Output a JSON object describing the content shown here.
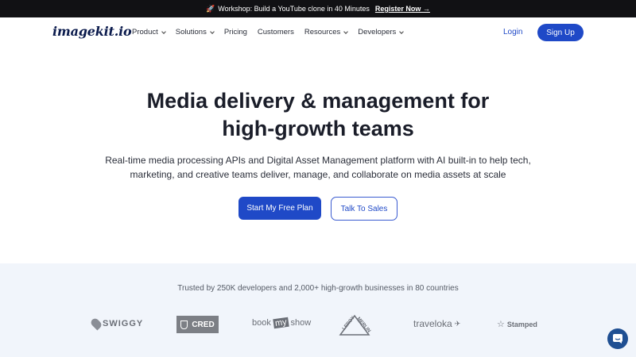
{
  "announcement": {
    "text": "Workshop: Build a YouTube clone in 40 Minutes",
    "link": "Register Now →",
    "icon": "rocket-icon"
  },
  "nav": {
    "logo": "imagekit.io",
    "items": [
      {
        "label": "Product",
        "dropdown": true
      },
      {
        "label": "Solutions",
        "dropdown": true
      },
      {
        "label": "Pricing",
        "dropdown": false
      },
      {
        "label": "Customers",
        "dropdown": false
      },
      {
        "label": "Resources",
        "dropdown": true
      },
      {
        "label": "Developers",
        "dropdown": true
      }
    ],
    "login": "Login",
    "signup": "Sign Up"
  },
  "hero": {
    "title_line1": "Media delivery & management for",
    "title_line2": "high-growth teams",
    "subtitle_line1": "Real-time media processing APIs and Digital Asset Management platform with AI built-in to help tech,",
    "subtitle_line2": "marketing, and creative teams deliver, manage, and collaborate on media assets at scale",
    "primary_cta": "Start My Free Plan",
    "secondary_cta": "Talk To Sales"
  },
  "trusted": {
    "text": "Trusted by 250K developers and 2,000+ high-growth businesses in 80 countries",
    "logos": {
      "swiggy": "SWIGGY",
      "cred": "CRED",
      "bookmyshow_a": "book",
      "bookmyshow_b": "my",
      "bookmyshow_c": "show",
      "leroy": "LEROY",
      "merlin": "MERLIN",
      "traveloka": "traveloka",
      "stamped": "Stamped"
    }
  },
  "colors": {
    "primary": "#1f49c7",
    "announcement_bg": "#111114",
    "trusted_bg": "#f1f5fb",
    "chat": "#1f4f92"
  }
}
